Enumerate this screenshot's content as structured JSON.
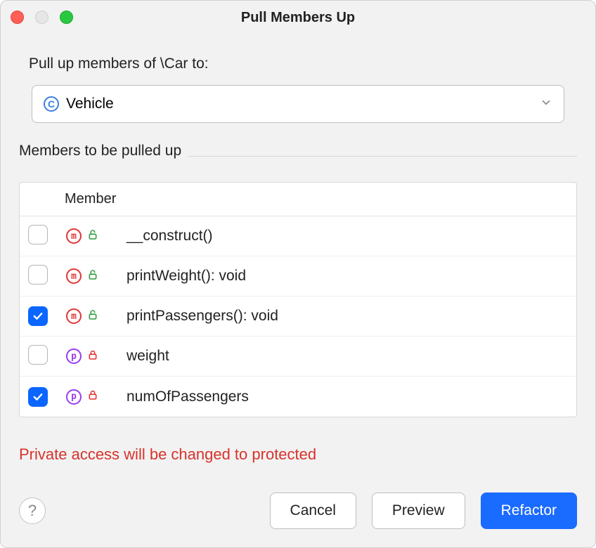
{
  "title": "Pull Members Up",
  "prompt": "Pull up members of \\Car to:",
  "target": {
    "label": "Vehicle"
  },
  "table": {
    "header": "Member",
    "section": "Members to be pulled up",
    "rows": [
      {
        "checked": false,
        "kind": "method",
        "visibility": "public",
        "label": "__construct()"
      },
      {
        "checked": false,
        "kind": "method",
        "visibility": "public",
        "label": "printWeight(): void"
      },
      {
        "checked": true,
        "kind": "method",
        "visibility": "public",
        "label": "printPassengers(): void"
      },
      {
        "checked": false,
        "kind": "property",
        "visibility": "private",
        "label": "weight"
      },
      {
        "checked": true,
        "kind": "property",
        "visibility": "private",
        "label": "numOfPassengers"
      }
    ]
  },
  "warning": "Private access will be changed to protected",
  "buttons": {
    "help": "?",
    "cancel": "Cancel",
    "preview": "Preview",
    "refactor": "Refactor"
  }
}
